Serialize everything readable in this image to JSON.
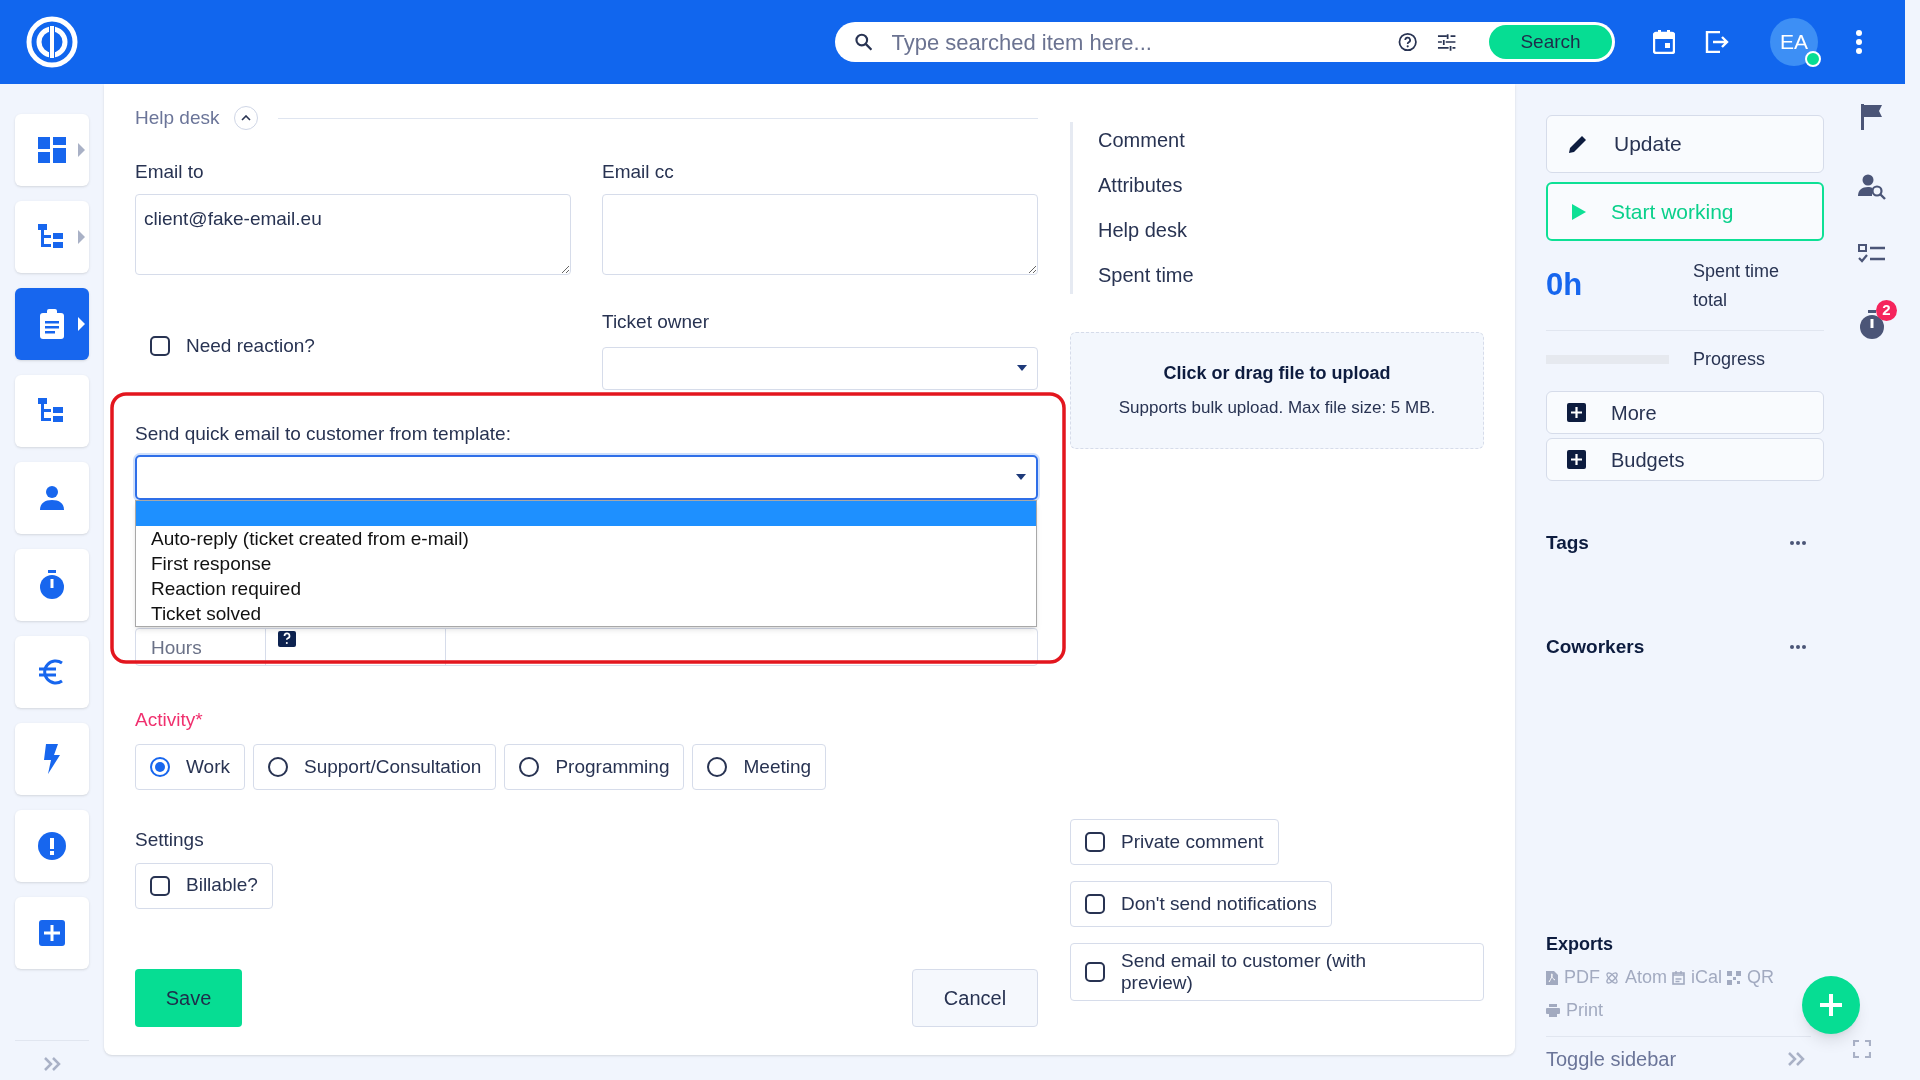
{
  "header": {
    "search": {
      "placeholder": "Type searched item here...",
      "button": "Search"
    },
    "avatar": {
      "initials": "EA",
      "online": true
    }
  },
  "left_rail": {
    "items": [
      {
        "selected": false,
        "submenu": true
      },
      {
        "selected": false,
        "submenu": true
      },
      {
        "selected": true,
        "submenu": true
      },
      {
        "selected": false,
        "submenu": false
      },
      {
        "selected": false,
        "submenu": false
      },
      {
        "selected": false,
        "submenu": false
      },
      {
        "selected": false,
        "submenu": false
      },
      {
        "selected": false,
        "submenu": false
      },
      {
        "selected": false,
        "submenu": false
      },
      {
        "selected": false,
        "submenu": false
      }
    ]
  },
  "help_desk": {
    "title": "Help desk",
    "expanded": true,
    "email_to": {
      "label": "Email to",
      "value": "client@fake-email.eu"
    },
    "email_cc": {
      "label": "Email cc"
    },
    "need_reaction": {
      "label": "Need reaction?",
      "checked": false
    },
    "ticket_owner": {
      "label": "Ticket owner"
    },
    "template": {
      "label": "Send quick email to customer from template:",
      "expanded": true,
      "blank_option_highlighted": true,
      "options": [
        {
          "label": "Auto-reply (ticket created from e-mail)",
          "selected": false
        },
        {
          "label": "First response",
          "selected": false
        },
        {
          "label": "Reaction required",
          "selected": false
        },
        {
          "label": "Ticket solved",
          "selected": false
        }
      ]
    },
    "hours": {
      "label": "Hours"
    }
  },
  "activity": {
    "label": "Activity*",
    "options": [
      {
        "label": "Work",
        "selected": true
      },
      {
        "label": "Support/Consultation",
        "selected": false
      },
      {
        "label": "Programming",
        "selected": false
      },
      {
        "label": "Meeting",
        "selected": false
      }
    ]
  },
  "settings": {
    "label": "Settings",
    "options": [
      {
        "label": "Billable?",
        "checked": false
      }
    ]
  },
  "buttons": {
    "save": "Save",
    "cancel": "Cancel"
  },
  "section_nav": [
    {
      "label": "Comment"
    },
    {
      "label": "Attributes"
    },
    {
      "label": "Help desk"
    },
    {
      "label": "Spent time"
    }
  ],
  "upload": {
    "title": "Click or drag file to upload",
    "hint": "Supports bulk upload. Max file size: 5 MB."
  },
  "extra_options": [
    {
      "label": "Private comment",
      "checked": false
    },
    {
      "label": "Don't send notifications",
      "checked": false
    },
    {
      "label": "Send email to customer (with preview)",
      "checked": false
    }
  ],
  "sidebar": {
    "update": "Update",
    "start_working": "Start working",
    "spent_value": "0h",
    "spent_label": "Spent time total",
    "progress": {
      "label": "Progress",
      "level": 0
    },
    "more": "More",
    "budgets": "Budgets",
    "tags": "Tags",
    "coworkers": "Coworkers",
    "exports": {
      "title": "Exports",
      "links": [
        "PDF",
        "Atom",
        "iCal",
        "QR"
      ],
      "print": "Print"
    },
    "toggle": "Toggle sidebar"
  },
  "right_strip": {
    "timer_badge": "2"
  }
}
